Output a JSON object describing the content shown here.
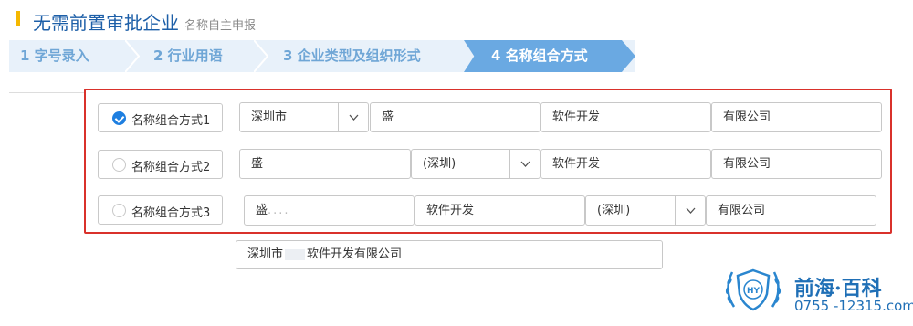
{
  "header": {
    "title": "无需前置审批企业",
    "subtitle": "名称自主申报"
  },
  "steps": [
    {
      "label": "1 字号录入"
    },
    {
      "label": "2 行业用语"
    },
    {
      "label": "3 企业类型及组织形式"
    },
    {
      "label": "4 名称组合方式"
    }
  ],
  "active_step": 4,
  "options": [
    {
      "label": "名称组合方式1",
      "checked": true,
      "fields": {
        "city": "深圳市",
        "name": "盛",
        "industry": "软件开发",
        "type": "有限公司"
      }
    },
    {
      "label": "名称组合方式2",
      "checked": false,
      "fields": {
        "name": "盛",
        "city": "(深圳)",
        "industry": "软件开发",
        "type": "有限公司"
      }
    },
    {
      "label": "名称组合方式3",
      "checked": false,
      "fields": {
        "name": "盛",
        "name_blur": "....",
        "industry": "软件开发",
        "city": "(深圳)",
        "type": "有限公司"
      }
    }
  ],
  "result": {
    "prefix": "深圳市",
    "suffix": "软件开发有限公司"
  },
  "brand": {
    "name": "前海·百科",
    "phone": "0755 -12315.com",
    "logo_text": "HY"
  },
  "colors": {
    "title": "#1d5fa8",
    "accent_bar": "#f5b800",
    "active_step": "#6aa9e2",
    "frame": "#d9312b",
    "checked": "#1e7fe0"
  }
}
